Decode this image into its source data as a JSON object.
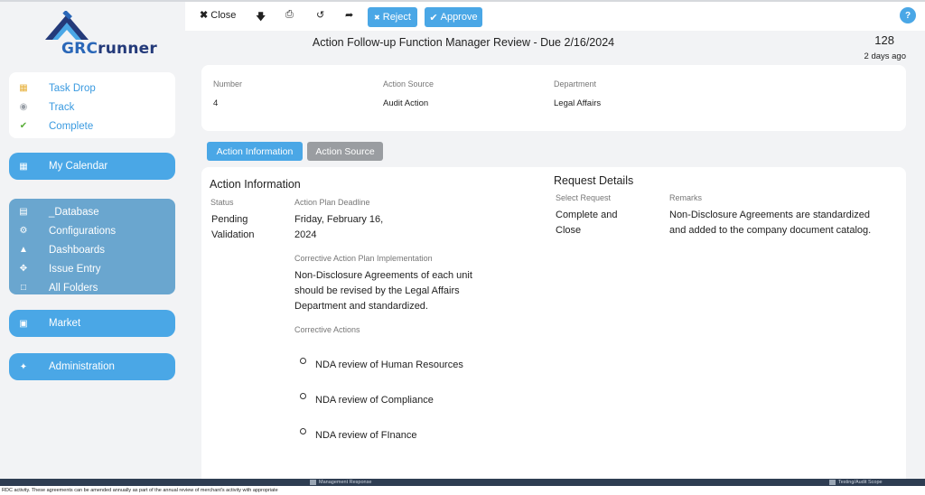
{
  "logo": {
    "part1": "GRC",
    "part2": "runner"
  },
  "sidebar": {
    "quick": [
      {
        "label": "Task Drop",
        "icon": "inbox-icon"
      },
      {
        "label": "Track",
        "icon": "binoculars-icon"
      },
      {
        "label": "Complete",
        "icon": "check-icon"
      }
    ],
    "calendar": {
      "label": "My Calendar",
      "icon": "calendar-icon"
    },
    "group": [
      {
        "label": "_Database",
        "icon": "database-icon"
      },
      {
        "label": "Configurations",
        "icon": "gears-icon"
      },
      {
        "label": "Dashboards",
        "icon": "area-chart-icon"
      },
      {
        "label": "Issue Entry",
        "icon": "crosshairs-icon"
      },
      {
        "label": "All Folders",
        "icon": "folder-icon"
      }
    ],
    "market": {
      "label": "Market",
      "icon": "cart-icon"
    },
    "administration": {
      "label": "Administration",
      "icon": "wrench-icon"
    }
  },
  "toolbar": {
    "close": "Close",
    "reject": "Reject",
    "approve": "Approve",
    "help": "?"
  },
  "page": {
    "title": "Action Follow-up Function Manager Review - Due 2/16/2024",
    "count": "128",
    "age": "2 days ago"
  },
  "header": {
    "number_label": "Number",
    "number_value": "4",
    "source_label": "Action Source",
    "source_value": "Audit Action",
    "department_label": "Department",
    "department_value": "Legal Affairs"
  },
  "tabs": {
    "info": "Action Information",
    "source": "Action Source"
  },
  "action_info": {
    "title": "Action Information",
    "status_label": "Status",
    "status_value": "Pending Validation",
    "deadline_label": "Action Plan Deadline",
    "deadline_value": "Friday, February 16, 2024",
    "implementation_label": "Corrective Action Plan Implementation",
    "implementation_value": "Non-Disclosure Agreements of each unit should be revised by the Legal Affairs Department and standardized.",
    "actions_label": "Corrective Actions",
    "actions": [
      "NDA review of Human Resources",
      "NDA review of Compliance",
      "NDA review of FInance"
    ]
  },
  "request": {
    "title": "Request Details",
    "select_label": "Select Request",
    "select_value": "Complete and Close",
    "remarks_label": "Remarks",
    "remarks_value": "Non-Disclosure Agreements are standardized and added to the company document catalog."
  },
  "bottom": {
    "col1": "Management Response",
    "col2": "Testing/Audit Scope",
    "note": "RDC activity. These agreements can be amended annually as part of the annual review of merchant's activity with appropriate"
  }
}
